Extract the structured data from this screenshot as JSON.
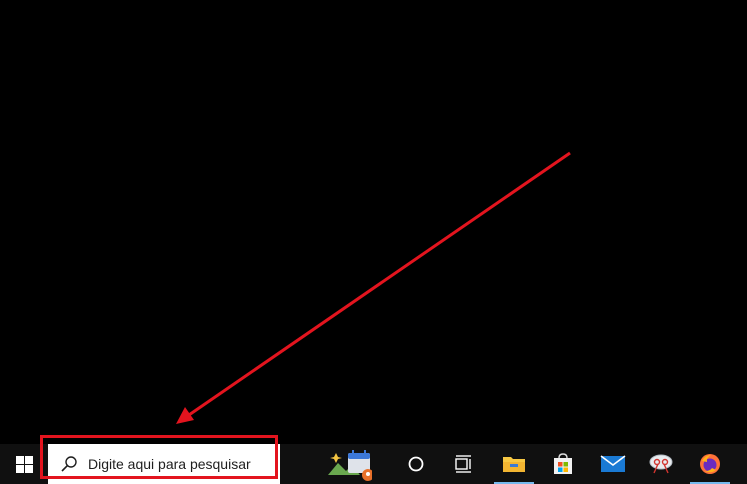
{
  "taskbar": {
    "search": {
      "placeholder": "Digite aqui para pesquisar"
    },
    "icons": [
      {
        "name": "windows-start-icon"
      },
      {
        "name": "search-icon"
      },
      {
        "name": "news-and-interests-icon"
      },
      {
        "name": "cortana-icon"
      },
      {
        "name": "task-view-icon"
      },
      {
        "name": "file-explorer-icon"
      },
      {
        "name": "microsoft-store-icon"
      },
      {
        "name": "mail-icon"
      },
      {
        "name": "snipping-tool-icon"
      },
      {
        "name": "firefox-icon"
      }
    ]
  },
  "annotation": {
    "color": "#e3141e"
  }
}
